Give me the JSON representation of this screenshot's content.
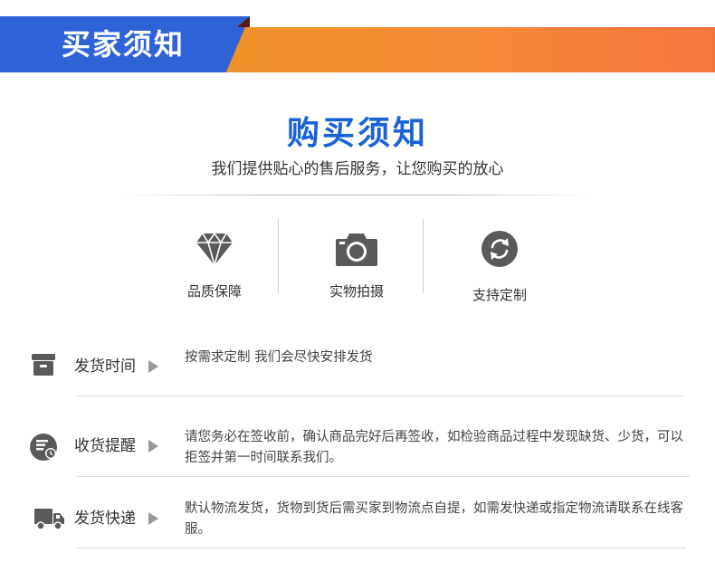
{
  "banner": {
    "title": "买家须知"
  },
  "header": {
    "title": "购买须知",
    "subtitle": "我们提供贴心的售后服务，让您购买的放心"
  },
  "features": [
    {
      "label": "品质保障",
      "icon": "diamond-icon"
    },
    {
      "label": "实物拍摄",
      "icon": "camera-icon"
    },
    {
      "label": "支持定制",
      "icon": "refresh-icon"
    }
  ],
  "rows": [
    {
      "label": "发货时间",
      "icon": "box-icon",
      "text": "按需求定制 我们会尽快安排发货"
    },
    {
      "label": "收货提醒",
      "icon": "receipt-clock-icon",
      "text": "请您务必在签收前，确认商品完好后再签收，如检验商品过程中发现缺货、少货，可以拒签并第一时间联系我们。"
    },
    {
      "label": "发货快递",
      "icon": "truck-icon",
      "text": "默认物流发货，货物到货后需买家到物流点自提，如需发快递或指定物流请联系在线客服。"
    }
  ],
  "colors": {
    "banner_blue": "#2d63d7",
    "banner_orange": "#f08a30",
    "title_blue": "#1a62d6",
    "icon_gray": "#5a5a5a"
  }
}
